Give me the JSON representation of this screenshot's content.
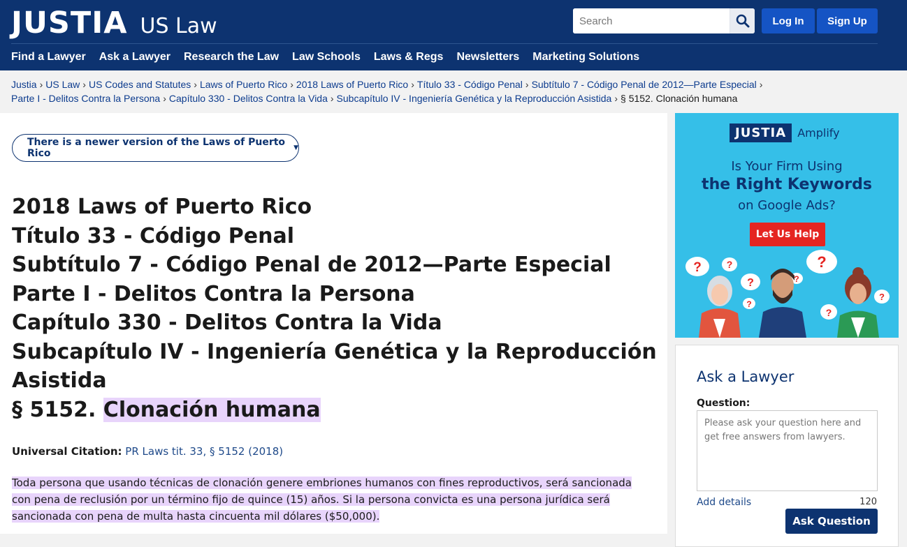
{
  "header": {
    "logo_main": "JUSTIA",
    "logo_sub": "US Law",
    "search_placeholder": "Search",
    "login_label": "Log In",
    "signup_label": "Sign Up",
    "nav": [
      "Find a Lawyer",
      "Ask a Lawyer",
      "Research the Law",
      "Law Schools",
      "Laws & Regs",
      "Newsletters",
      "Marketing Solutions"
    ]
  },
  "breadcrumbs": [
    "Justia",
    "US Law",
    "US Codes and Statutes",
    "Laws of Puerto Rico",
    "2018 Laws of Puerto Rico",
    "Título 33 - Código Penal",
    "Subtítulo 7 - Código Penal de 2012—Parte Especial",
    "Parte I - Delitos Contra la Persona",
    "Capítulo 330 - Delitos Contra la Vida",
    "Subcapítulo IV - Ingeniería Genética y la Reproducción Asistida"
  ],
  "breadcrumb_current": "§ 5152. Clonación humana",
  "version_notice": "There is a newer version of the Laws of Puerto Rico",
  "titles": [
    "2018 Laws of Puerto Rico",
    "Título 33 - Código Penal",
    "Subtítulo 7 - Código Penal de 2012—Parte Especial",
    "Parte I - Delitos Contra la Persona",
    "Capítulo 330 - Delitos Contra la Vida",
    "Subcapítulo IV - Ingeniería Genética y la Reproducción",
    "Asistida"
  ],
  "section_prefix": "§ 5152.",
  "section_name": "Clonación humana",
  "citation_label": "Universal Citation:",
  "citation_value": "PR Laws tit. 33, § 5152 (2018)",
  "body_lines": [
    "Toda persona que usando técnicas de clonación genere embriones humanos con fines reproductivos, será sancionada",
    "con pena de reclusión por un término fijo de quince (15) años. Si la persona convicta es una persona jurídica será",
    "sancionada con pena de multa hasta cincuenta mil dólares ($50,000)."
  ],
  "ad": {
    "logo_box": "JUSTIA",
    "logo_word": "Amplify",
    "line1": "Is Your Firm Using",
    "line2": "the Right Keywords",
    "line3": "on Google Ads?",
    "cta": "Let Us Help",
    "question_mark": "?"
  },
  "ask": {
    "title": "Ask a Lawyer",
    "question_label": "Question:",
    "placeholder": "Please ask your question here and get free answers from lawyers.",
    "details": "Add details",
    "count": "120",
    "button": "Ask Question"
  },
  "colors": {
    "header_bg": "#0d3370",
    "button_blue": "#1554c4",
    "highlight": "#e8d4fb",
    "ad_bg": "#35bfe8",
    "cta_red": "#e52521"
  }
}
